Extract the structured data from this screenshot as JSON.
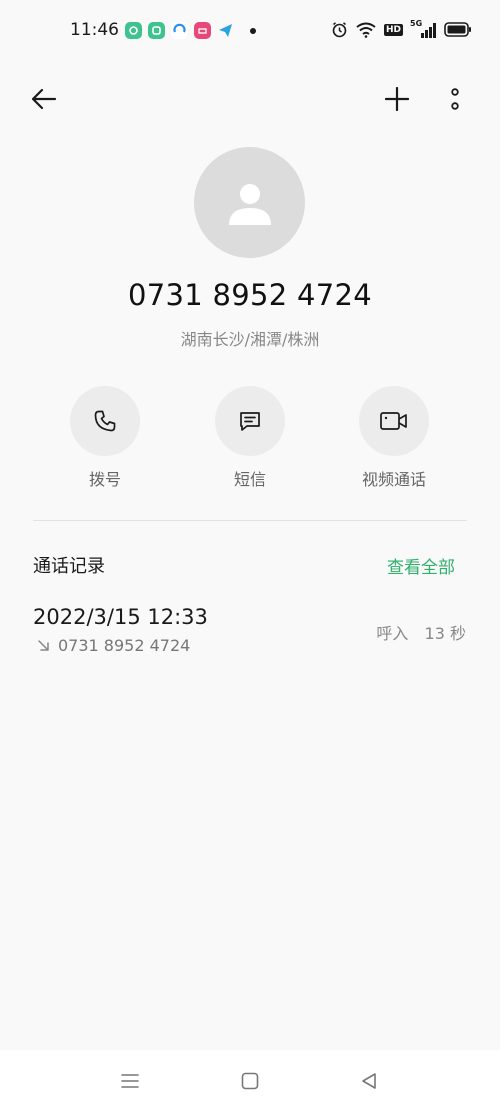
{
  "status_bar": {
    "time": "11:46",
    "network": "5G",
    "hd": "HD"
  },
  "contact": {
    "number": "0731 8952 4724",
    "location": "湖南长沙/湘潭/株洲"
  },
  "actions": {
    "call_label": "拨号",
    "sms_label": "短信",
    "video_label": "视频通话"
  },
  "history": {
    "title": "通话记录",
    "view_all": "查看全部",
    "entries": [
      {
        "date": "2022/3/15 12:33",
        "number": "0731 8952 4724",
        "type": "呼入",
        "duration": "13 秒"
      }
    ]
  },
  "colors": {
    "accent": "#2fb06c",
    "avatar_bg": "#dcdcdc",
    "action_bg": "#ececec"
  }
}
